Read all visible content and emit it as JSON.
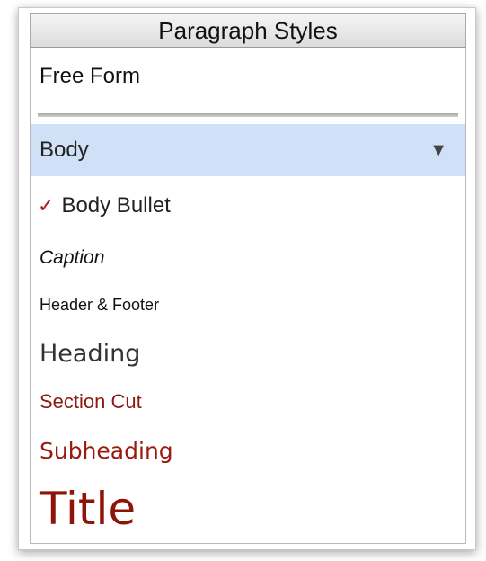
{
  "panel": {
    "title": "Paragraph Styles"
  },
  "styles": {
    "free_form": "Free Form",
    "body": "Body",
    "body_bullet": "Body Bullet",
    "caption": "Caption",
    "header_footer": "Header & Footer",
    "heading": "Heading",
    "section_cut": "Section Cut",
    "subheading": "Subheading",
    "title": "Title"
  },
  "selected_style": "Body",
  "checked_style": "Body Bullet",
  "icons": {
    "check": "check-icon",
    "dropdown": "dropdown-arrow-icon"
  },
  "colors": {
    "highlight": "#cfe0f7",
    "accent_red": "#8e1409",
    "check_red": "#b3150f"
  }
}
